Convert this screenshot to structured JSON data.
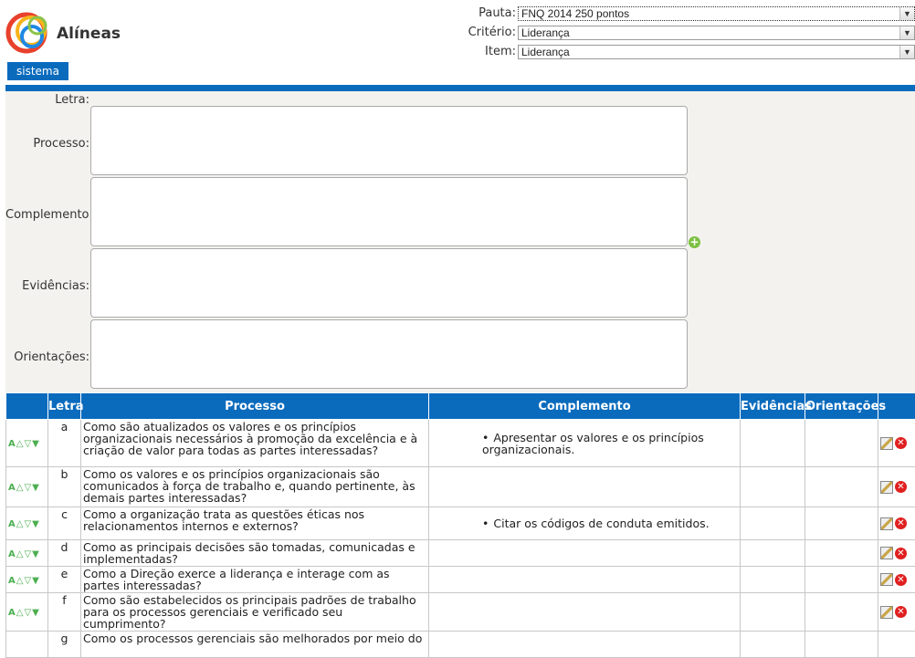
{
  "app": {
    "title": "Alíneas"
  },
  "filters": [
    {
      "label": "Pauta:",
      "value": "FNQ 2014 250 pontos"
    },
    {
      "label": "Critério:",
      "value": "Liderança"
    },
    {
      "label": "Item:",
      "value": "Liderança"
    }
  ],
  "menu": {
    "label": "sistema"
  },
  "form": {
    "letra_label": "Letra:",
    "processo_label": "Processo:",
    "complemento_label": "Complemento:",
    "evidencias_label": "Evidências:",
    "orientacoes_label": "Orientações:"
  },
  "table": {
    "headers": [
      "",
      "Letra",
      "Processo",
      "Complemento",
      "Evidências",
      "Orientações",
      ""
    ],
    "rows": [
      {
        "letra": "a",
        "processo": "Como são atualizados os valores e os princípios organizacionais necessários à promoção da excelência e à criação de valor para todas as partes interessadas?",
        "complemento": "Apresentar os valores e os princípios organizacionais."
      },
      {
        "letra": "b",
        "processo": "Como os valores e os princípios organizacionais são comunicados à força de trabalho e, quando pertinente, às demais partes interessadas?",
        "complemento": ""
      },
      {
        "letra": "c",
        "processo": "Como a organização trata as questões éticas nos relacionamentos internos e externos?",
        "complemento": "Citar os códigos de conduta emitidos."
      },
      {
        "letra": "d",
        "processo": "Como as principais decisões são tomadas, comunicadas e implementadas?",
        "complemento": ""
      },
      {
        "letra": "e",
        "processo": "Como a Direção exerce a liderança e interage com as partes interessadas?",
        "complemento": ""
      },
      {
        "letra": "f",
        "processo": "Como são estabelecidos os principais padrões de trabalho para os processos gerenciais e verificado seu cumprimento?",
        "complemento": ""
      },
      {
        "letra": "g",
        "processo": "Como os processos gerenciais são melhorados por meio do",
        "complemento": ""
      }
    ]
  },
  "icons": {
    "ops": [
      "font-icon",
      "up-arrow-icon",
      "down-arrow-icon",
      "down-filled-icon"
    ],
    "edit": "edit-icon",
    "delete": "delete-icon"
  },
  "colors": {
    "accent": "#0a6bbd",
    "form_bg": "#f3f2ef"
  }
}
